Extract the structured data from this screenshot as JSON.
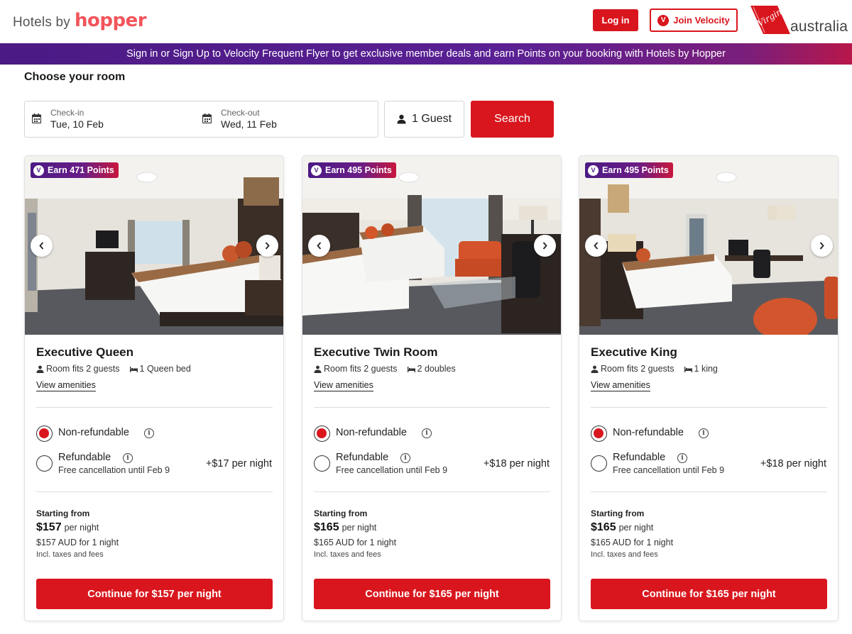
{
  "header": {
    "logo_prefix": "Hotels by",
    "logo_brand": "hopper",
    "login_label": "Log in",
    "velocity_badge": "V",
    "join_velocity_label": "Join Velocity",
    "partner_logo_script": "Virgin",
    "partner_logo_text": "australia"
  },
  "banner": {
    "text": "Sign in or Sign Up to Velocity Frequent Flyer to get exclusive member deals and earn Points on your booking with Hotels by Hopper"
  },
  "search": {
    "section_title": "Choose your room",
    "checkin_label": "Check-in",
    "checkin_value": "Tue, 10 Feb",
    "checkout_label": "Check-out",
    "checkout_value": "Wed, 11 Feb",
    "guests_value": "1 Guest",
    "search_label": "Search"
  },
  "rooms": [
    {
      "points_badge": "Earn 471 Points",
      "name": "Executive Queen",
      "capacity": "Room fits 2 guests",
      "beds": "1 Queen bed",
      "amenities_link": "View amenities",
      "option_nonrefundable": "Non-refundable",
      "option_refundable": "Refundable",
      "refundable_sub": "Free cancellation until Feb 9",
      "refundable_price": "+$17 per night",
      "starting_label": "Starting from",
      "price": "$157",
      "per_night": "per night",
      "total": "$157 AUD for 1 night",
      "taxes": "Incl. taxes and fees",
      "cta": "Continue for $157 per night"
    },
    {
      "points_badge": "Earn 495 Points",
      "name": "Executive Twin Room",
      "capacity": "Room fits 2 guests",
      "beds": "2 doubles",
      "amenities_link": "View amenities",
      "option_nonrefundable": "Non-refundable",
      "option_refundable": "Refundable",
      "refundable_sub": "Free cancellation until Feb 9",
      "refundable_price": "+$18 per night",
      "starting_label": "Starting from",
      "price": "$165",
      "per_night": "per night",
      "total": "$165 AUD for 1 night",
      "taxes": "Incl. taxes and fees",
      "cta": "Continue for $165 per night"
    },
    {
      "points_badge": "Earn 495 Points",
      "name": "Executive King",
      "capacity": "Room fits 2 guests",
      "beds": "1 king",
      "amenities_link": "View amenities",
      "option_nonrefundable": "Non-refundable",
      "option_refundable": "Refundable",
      "refundable_sub": "Free cancellation until Feb 9",
      "refundable_price": "+$18 per night",
      "starting_label": "Starting from",
      "price": "$165",
      "per_night": "per night",
      "total": "$165 AUD for 1 night",
      "taxes": "Incl. taxes and fees",
      "cta": "Continue for $165 per night"
    }
  ],
  "icons": {
    "calendar": "calendar-icon",
    "person": "person-icon",
    "bed": "bed-icon",
    "info": "info-icon",
    "chevron_left": "chevron-left-icon",
    "chevron_right": "chevron-right-icon"
  },
  "colors": {
    "primary_red": "#d9161d",
    "velocity_purple": "#4b1a84",
    "hopper_coral": "#f2545b"
  }
}
